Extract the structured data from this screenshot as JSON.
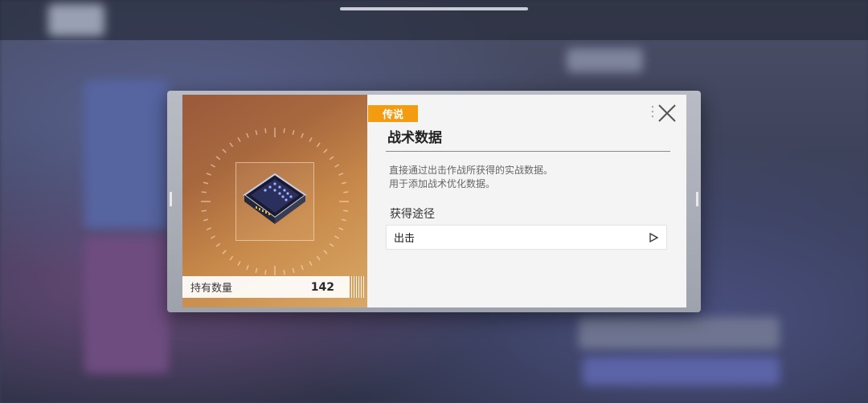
{
  "item": {
    "rarity_label": "传说",
    "name": "战术数据",
    "description_line1": "直接通过出击作战所获得的实战数据。",
    "description_line2": "用于添加战术优化数据。",
    "count_label": "持有数量",
    "count_value": "142"
  },
  "sources": {
    "heading": "获得途径",
    "items": [
      {
        "label": "出击"
      }
    ]
  },
  "colors": {
    "rarity_badge": "#f39c12",
    "card_gradient_start": "#9a5a3c",
    "card_gradient_end": "#d9a866",
    "panel_bg": "#f4f4f5"
  },
  "icons": {
    "item_icon": "data-chip-icon",
    "close": "close-icon",
    "go": "play-icon"
  }
}
